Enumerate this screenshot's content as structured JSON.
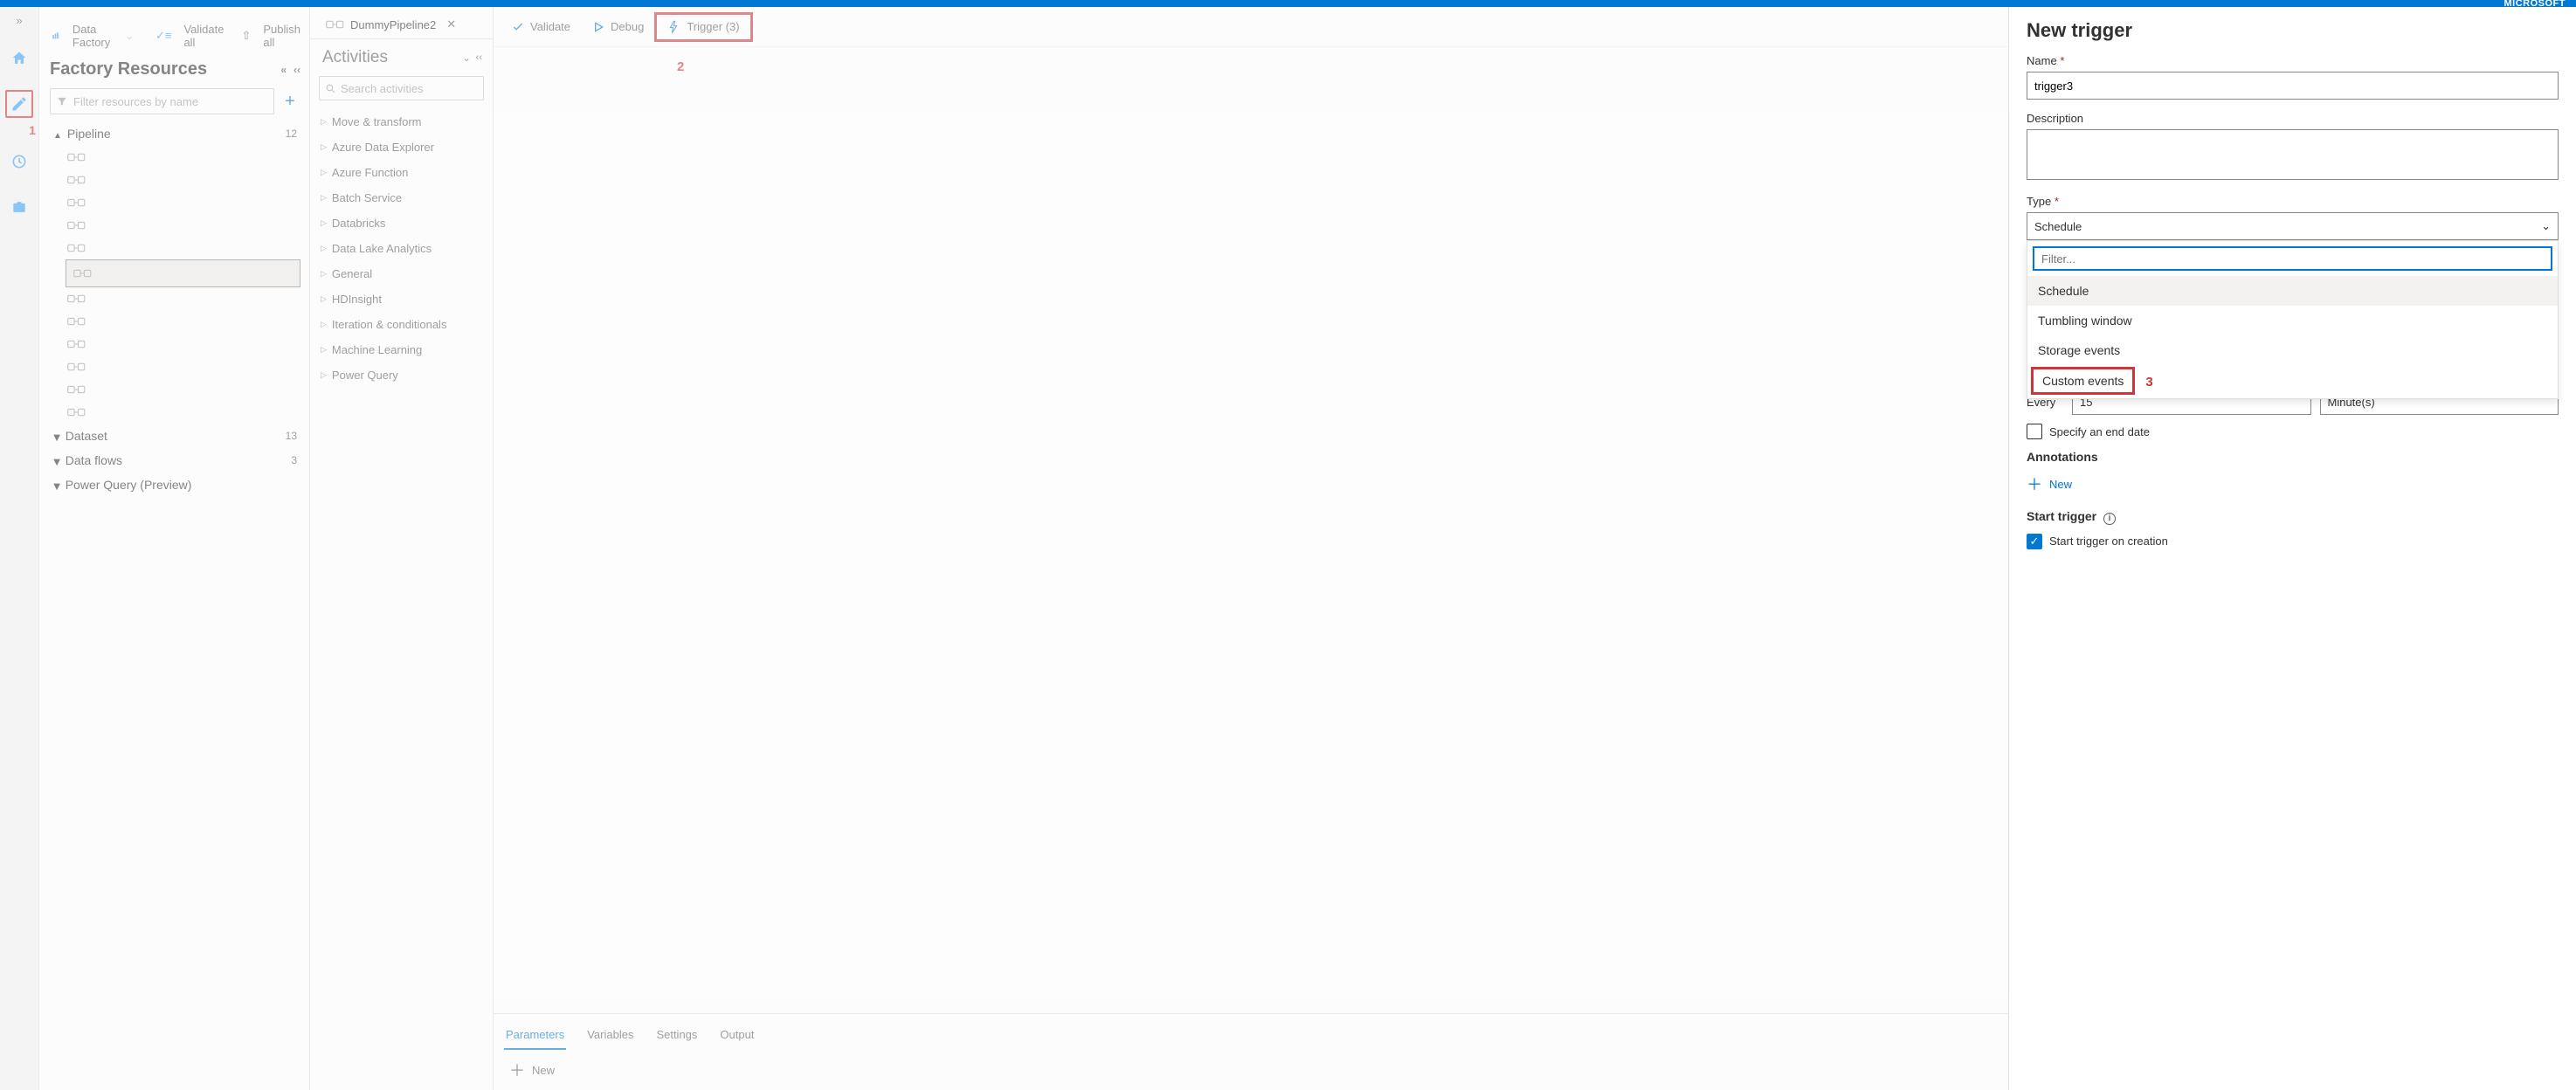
{
  "brand": "MICROSOFT",
  "left_rail": {
    "annotation_1": "1"
  },
  "crumbs": {
    "data_factory": "Data Factory",
    "validate_all": "Validate all",
    "publish_all": "Publish all"
  },
  "resources": {
    "title": "Factory Resources",
    "filter_placeholder": "Filter resources by name",
    "sections": {
      "pipeline": {
        "label": "Pipeline",
        "count": "12"
      },
      "dataset": {
        "label": "Dataset",
        "count": "13"
      },
      "dataflows": {
        "label": "Data flows",
        "count": "3"
      },
      "powerquery": {
        "label": "Power Query (Preview)",
        "count": ""
      }
    }
  },
  "tab": {
    "name": "DummyPipeline2"
  },
  "activities": {
    "title": "Activities",
    "search_placeholder": "Search activities",
    "cats": [
      "Move & transform",
      "Azure Data Explorer",
      "Azure Function",
      "Batch Service",
      "Databricks",
      "Data Lake Analytics",
      "General",
      "HDInsight",
      "Iteration & conditionals",
      "Machine Learning",
      "Power Query"
    ]
  },
  "canvas": {
    "validate": "Validate",
    "debug": "Debug",
    "trigger": "Trigger (3)",
    "annotation_2": "2",
    "bottom": {
      "tabs": [
        "Parameters",
        "Variables",
        "Settings",
        "Output"
      ],
      "new": "New"
    }
  },
  "panel": {
    "title": "New trigger",
    "name_label": "Name",
    "name_value": "trigger3",
    "desc_label": "Description",
    "type_label": "Type",
    "type_value": "Schedule",
    "filter_placeholder": "Filter...",
    "options": [
      "Schedule",
      "Tumbling window",
      "Storage events",
      "Custom events"
    ],
    "annotation_3": "3",
    "every_label": "Every",
    "every_value": "15",
    "every_unit": "Minute(s)",
    "end_date": "Specify an end date",
    "annotations_label": "Annotations",
    "new": "New",
    "start_trigger_label": "Start trigger",
    "start_trigger_check": "Start trigger on creation"
  }
}
